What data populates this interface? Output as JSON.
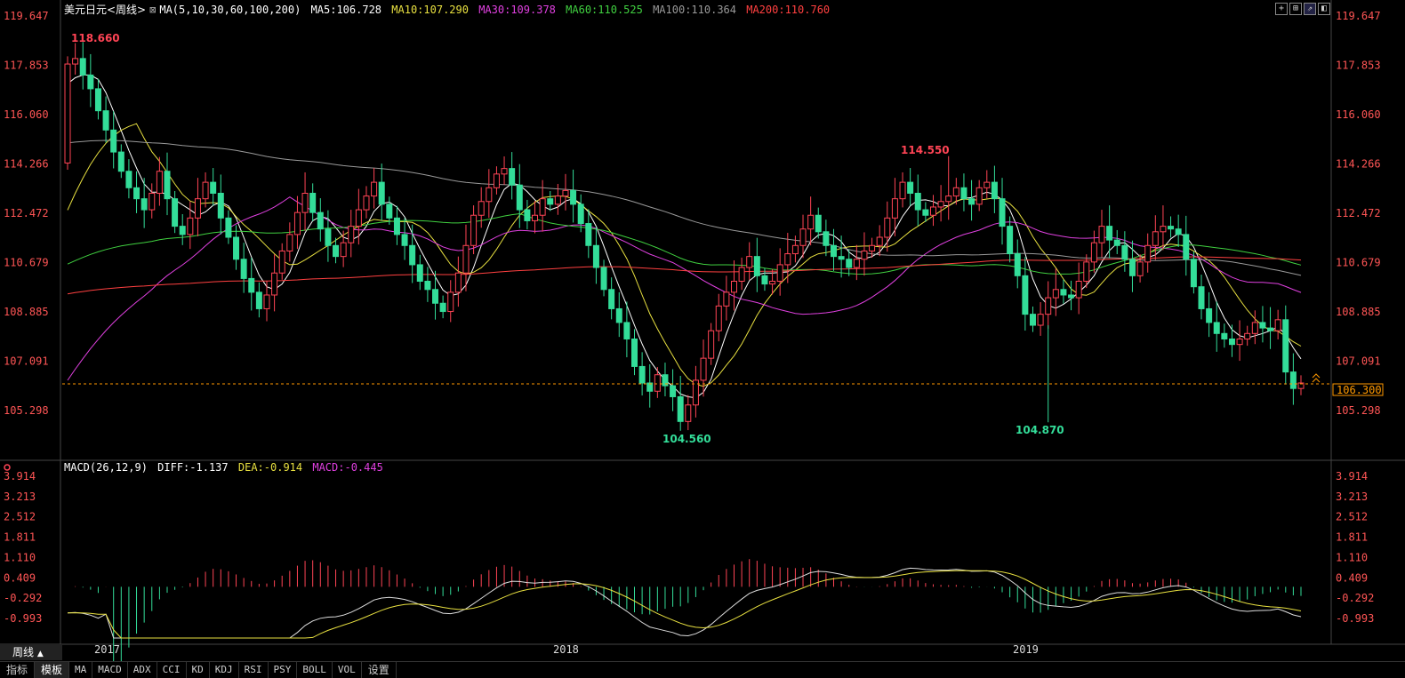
{
  "legend_main": {
    "symbol": "美元日元<周线>",
    "ma_params": "MA(5,10,30,60,100,200)",
    "ma5": "MA5:106.728",
    "ma10": "MA10:107.290",
    "ma30": "MA30:109.378",
    "ma60": "MA60:110.525",
    "ma100": "MA100:110.364",
    "ma200": "MA200:110.760"
  },
  "legend_macd": {
    "params": "MACD(26,12,9)",
    "diff": "DIFF:-1.137",
    "dea": "DEA:-0.914",
    "macd": "MACD:-0.445"
  },
  "price_axis": [
    "119.647",
    "117.853",
    "116.060",
    "114.266",
    "112.472",
    "110.679",
    "108.885",
    "107.091",
    "105.298"
  ],
  "macd_axis": [
    "3.914",
    "3.213",
    "2.512",
    "1.811",
    "1.110",
    "0.409",
    "-0.292",
    "-0.993"
  ],
  "current_price": "106.300",
  "annotations": {
    "high1": "118.660",
    "high2": "114.550",
    "low1": "104.560",
    "low2": "104.870"
  },
  "time_labels": [
    "2017",
    "2018",
    "2019"
  ],
  "period": "周线",
  "bottom_tabs": [
    "指标",
    "模板",
    "MA",
    "MACD",
    "ADX",
    "CCI",
    "KD",
    "KDJ",
    "RSI",
    "PSY",
    "BOLL",
    "VOL",
    "设置"
  ],
  "colors": {
    "up": "#ff4455",
    "down": "#33dd99",
    "ma5": "#ffffff",
    "ma10": "#e8e040",
    "ma30": "#e040e0",
    "ma60": "#40d040",
    "ma100": "#999999",
    "ma200": "#ff4040",
    "axis_text": "#ff5555"
  },
  "chart_data": {
    "type": "candlestick",
    "close": [
      117.9,
      118.1,
      117.5,
      117.0,
      116.2,
      115.5,
      114.7,
      114.0,
      113.4,
      113.0,
      112.6,
      113.2,
      114.0,
      113.0,
      112.0,
      111.7,
      112.3,
      113.0,
      113.6,
      113.2,
      112.3,
      111.6,
      110.8,
      110.1,
      109.6,
      109.0,
      109.5,
      110.3,
      111.1,
      111.7,
      112.5,
      113.2,
      112.5,
      111.9,
      111.3,
      110.9,
      111.4,
      112.0,
      112.6,
      113.1,
      113.6,
      112.8,
      112.3,
      111.7,
      111.3,
      110.6,
      110.0,
      109.7,
      109.2,
      108.9,
      109.6,
      110.3,
      111.3,
      112.4,
      112.9,
      113.4,
      113.9,
      114.1,
      113.5,
      112.6,
      112.2,
      112.4,
      113.0,
      112.8,
      113.1,
      113.3,
      112.8,
      112.1,
      111.3,
      110.5,
      109.7,
      109.0,
      108.5,
      107.9,
      106.9,
      106.3,
      106.0,
      106.6,
      106.2,
      105.8,
      104.9,
      105.5,
      106.4,
      107.2,
      108.2,
      109.1,
      109.6,
      110.0,
      110.5,
      110.9,
      110.2,
      109.9,
      110.0,
      110.6,
      111.0,
      111.3,
      111.9,
      112.4,
      111.8,
      111.3,
      110.9,
      110.8,
      110.5,
      110.8,
      111.1,
      111.3,
      111.6,
      112.3,
      113.0,
      113.6,
      113.2,
      112.6,
      112.4,
      112.7,
      112.9,
      113.1,
      113.4,
      113.0,
      112.8,
      113.4,
      113.6,
      113.0,
      112.0,
      111.0,
      110.2,
      108.8,
      108.4,
      108.8,
      109.4,
      109.7,
      109.5,
      109.4,
      110.0,
      110.7,
      111.4,
      112.0,
      111.5,
      111.3,
      110.8,
      110.2,
      110.7,
      111.3,
      111.8,
      112.0,
      111.9,
      111.7,
      110.8,
      109.8,
      109.0,
      108.5,
      108.1,
      107.9,
      107.7,
      107.9,
      108.1,
      108.5,
      108.3,
      108.2,
      108.6,
      106.7,
      106.1,
      106.3
    ]
  }
}
